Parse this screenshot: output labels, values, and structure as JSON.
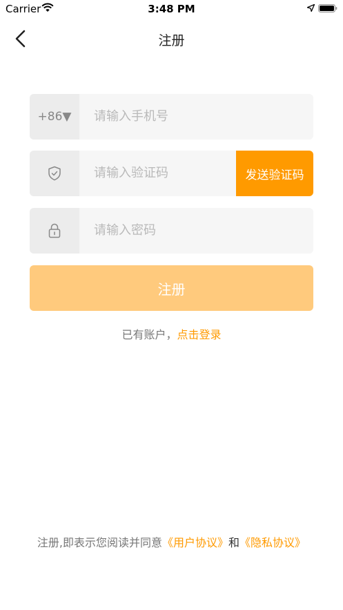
{
  "status_bar": {
    "carrier": "Carrier",
    "time": "3:48 PM",
    "icons": [
      "wifi-icon",
      "location-icon",
      "battery-icon"
    ]
  },
  "nav": {
    "title": "注册",
    "back_icon": "chevron-left-icon"
  },
  "form": {
    "phone": {
      "prefix": "+86▼",
      "placeholder": "请输入手机号",
      "value": ""
    },
    "code": {
      "icon": "shield-check-icon",
      "placeholder": "请输入验证码",
      "value": "",
      "send_label": "发送验证码"
    },
    "password": {
      "icon": "lock-icon",
      "placeholder": "请输入密码",
      "value": ""
    },
    "submit_label": "注册"
  },
  "login_prompt": {
    "text": "已有账户，",
    "link": "点击登录"
  },
  "agreement": {
    "prefix": "注册,即表示您阅读并同意",
    "user_agreement": "《用户协议》",
    "and": "和",
    "privacy_policy": "《隐私协议》"
  },
  "colors": {
    "accent": "#ff9a00",
    "submit_disabled": "#ffca7d",
    "field_bg": "#f6f6f6",
    "prefix_bg": "#ececec"
  }
}
